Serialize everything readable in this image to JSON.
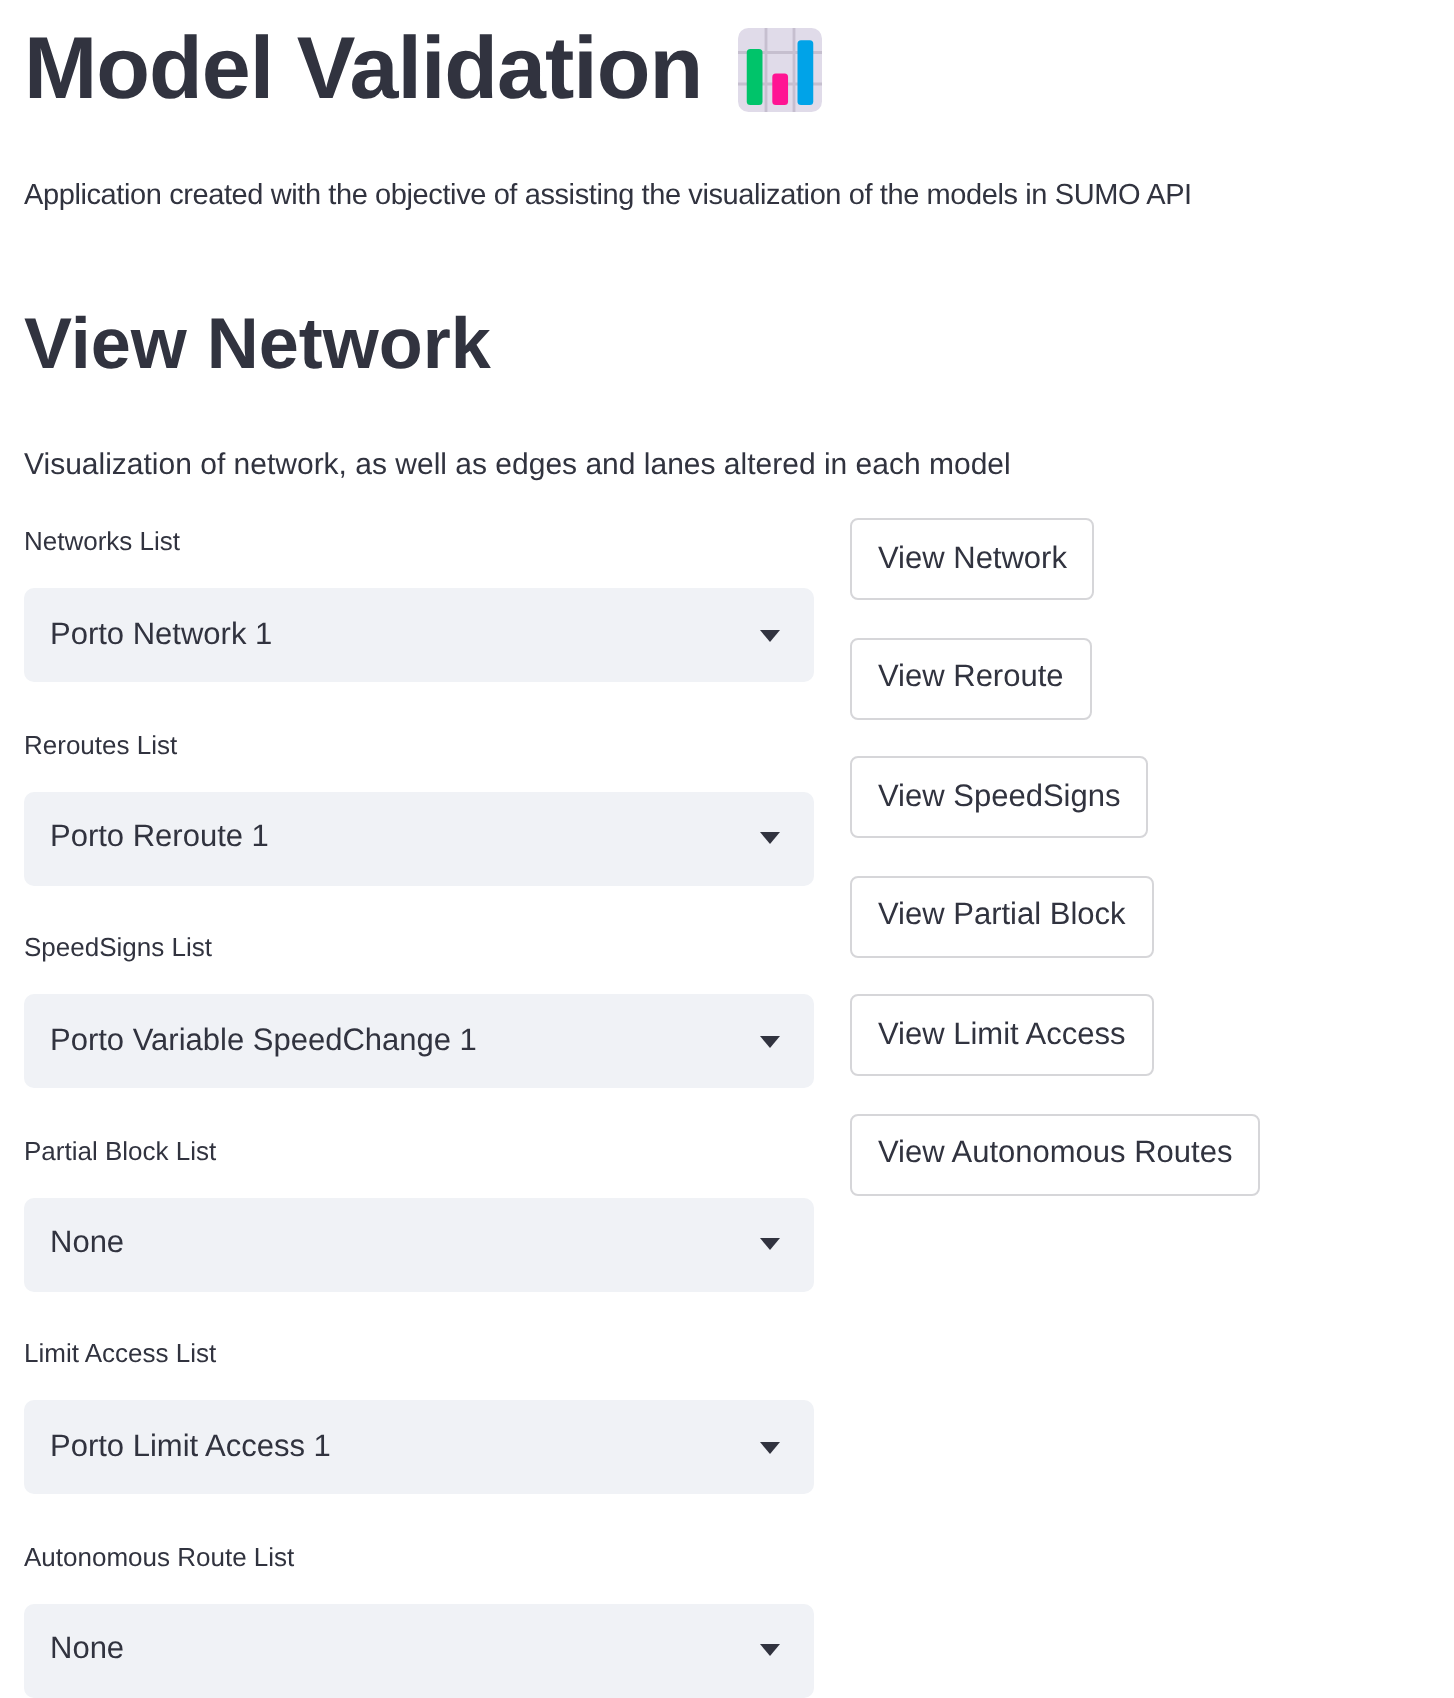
{
  "title": "Model Validation",
  "description": "Application created with the objective of assisting the visualization of the models in SUMO API",
  "section": {
    "heading": "View Network",
    "description": "Visualization of network, as well as edges and lanes altered in each model"
  },
  "selects": [
    {
      "label": "Networks List",
      "value": "Porto Network 1"
    },
    {
      "label": "Reroutes List",
      "value": "Porto Reroute 1"
    },
    {
      "label": "SpeedSigns List",
      "value": "Porto Variable SpeedChange 1"
    },
    {
      "label": "Partial Block List",
      "value": "None"
    },
    {
      "label": "Limit Access List",
      "value": "Porto Limit Access 1"
    },
    {
      "label": "Autonomous Route List",
      "value": "None"
    }
  ],
  "buttons": [
    "View Network",
    "View Reroute",
    "View SpeedSigns",
    "View Partial Block",
    "View Limit Access",
    "View Autonomous Routes"
  ]
}
